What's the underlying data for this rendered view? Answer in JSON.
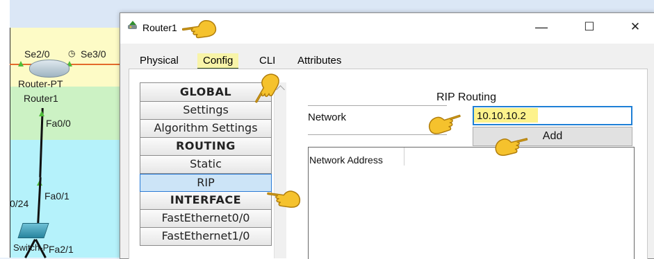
{
  "canvas": {
    "labels": {
      "se2_0": "Se2/0",
      "se3_0": "Se3/0",
      "device_type": "Router-PT",
      "router_name": "Router1",
      "fa0_0": "Fa0/0",
      "fa0_1": "Fa0/1",
      "subnet": "0/24",
      "switch_name": "Switch-P",
      "fa2_1": "Fa2/1",
      "clock": "◷"
    }
  },
  "window": {
    "title": "Router1",
    "minimize": "—",
    "maximize": "☐",
    "close": "✕",
    "icon": "router-app-icon"
  },
  "tabs": [
    {
      "label": "Physical"
    },
    {
      "label": "Config",
      "active": true
    },
    {
      "label": "CLI"
    },
    {
      "label": "Attributes"
    }
  ],
  "nav": {
    "items": [
      {
        "label": "GLOBAL",
        "header": true
      },
      {
        "label": "Settings"
      },
      {
        "label": "Algorithm Settings"
      },
      {
        "label": "ROUTING",
        "header": true
      },
      {
        "label": "Static"
      },
      {
        "label": "RIP",
        "selected": true
      },
      {
        "label": "INTERFACE",
        "header": true
      },
      {
        "label": "FastEthernet0/0"
      },
      {
        "label": "FastEthernet1/0"
      }
    ]
  },
  "rip": {
    "title": "RIP Routing",
    "network_label": "Network",
    "network_value": "10.10.10.2",
    "add_label": "Add",
    "table_header": "Network Address"
  },
  "colors": {
    "highlight": "#fdf28c",
    "selection": "#cce4f7",
    "focus_border": "#1e7fd6",
    "serial_link": "#e36a2c",
    "hand": "#f5c22d"
  }
}
